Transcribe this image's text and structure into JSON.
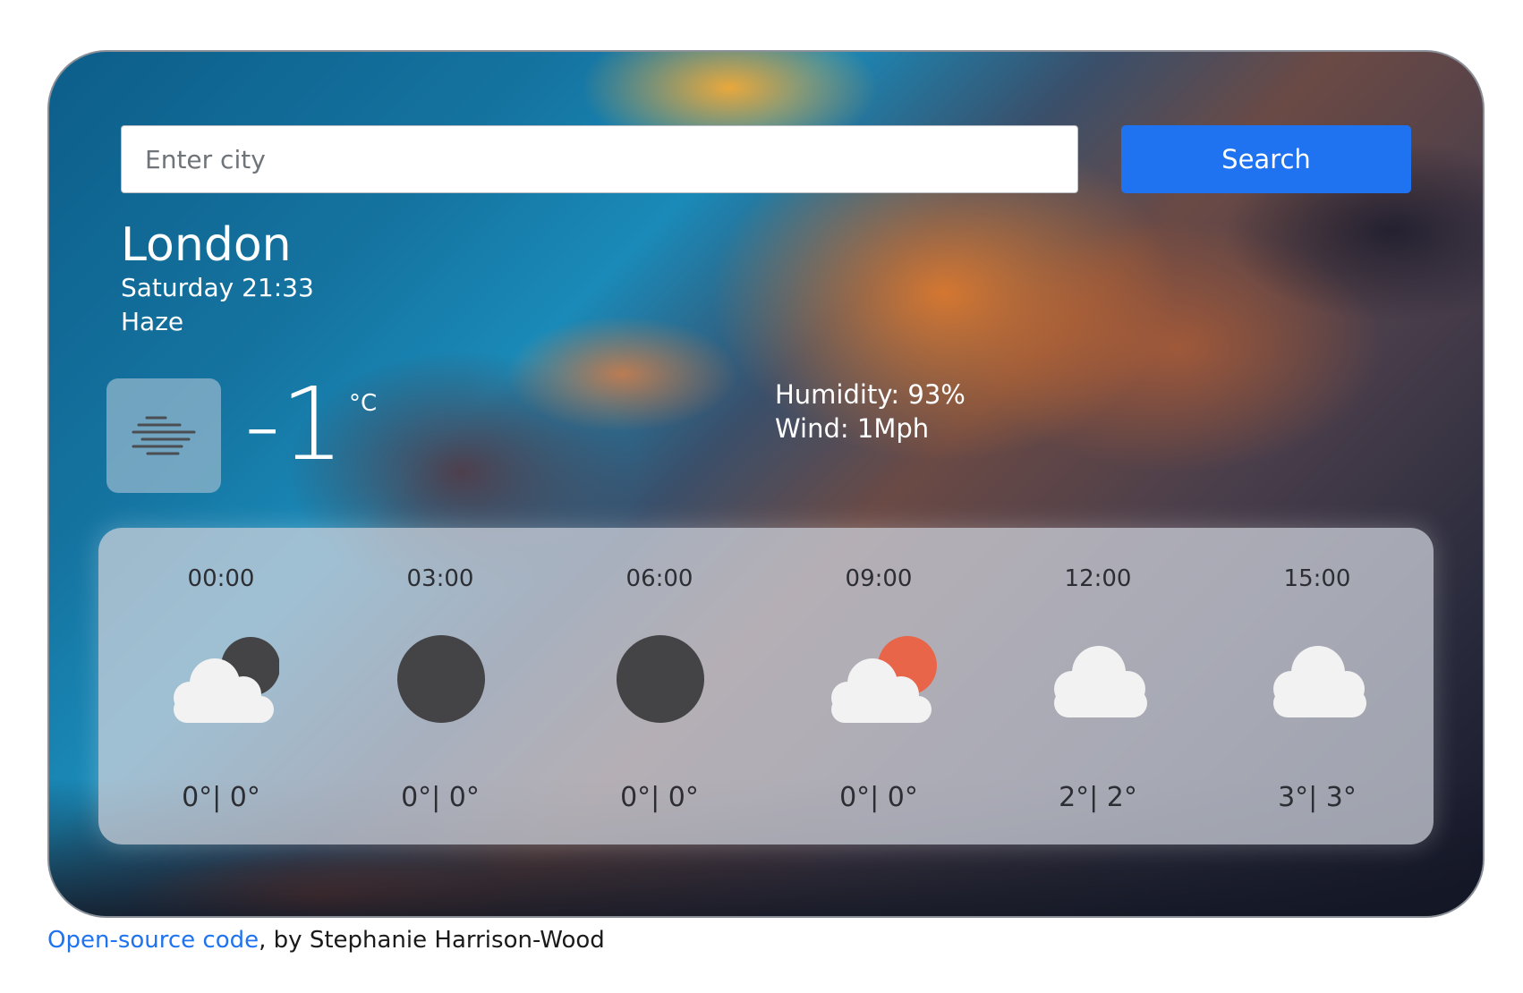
{
  "search": {
    "placeholder": "Enter city",
    "button_label": "Search"
  },
  "current": {
    "city": "London",
    "datetime": "Saturday 21:33",
    "description": "Haze",
    "icon": "haze-icon",
    "temperature": "-1",
    "unit": "°C",
    "humidity": "Humidity: 93%",
    "wind": "Wind: 1Mph"
  },
  "forecast": [
    {
      "time": "00:00",
      "icon": "cloudy-night-icon",
      "temps": "0°| 0°"
    },
    {
      "time": "03:00",
      "icon": "clear-night-icon",
      "temps": "0°| 0°"
    },
    {
      "time": "06:00",
      "icon": "clear-night-icon",
      "temps": "0°| 0°"
    },
    {
      "time": "09:00",
      "icon": "partly-sunny-icon",
      "temps": "0°| 0°"
    },
    {
      "time": "12:00",
      "icon": "cloud-icon",
      "temps": "2°| 2°"
    },
    {
      "time": "15:00",
      "icon": "cloud-icon",
      "temps": "3°| 3°"
    }
  ],
  "footer": {
    "link_text": "Open-source code",
    "suffix": ", by Stephanie Harrison-Wood"
  },
  "colors": {
    "accent": "#1f73f0",
    "sun": "#e8654a",
    "moon": "#444446",
    "cloud": "#f2f2f2"
  }
}
